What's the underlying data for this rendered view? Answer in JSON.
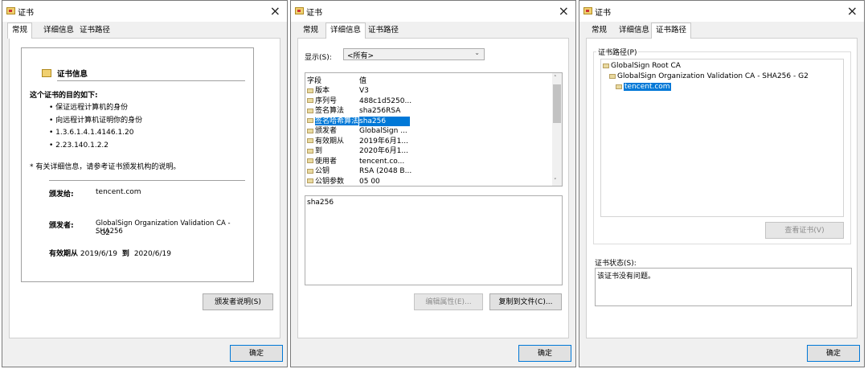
{
  "window_title": "证书",
  "close_glyph": "×",
  "tabs": [
    "常规",
    "详细信息",
    "证书路径"
  ],
  "ok_label": "确定",
  "general": {
    "info_header": "证书信息",
    "purpose_heading": "这个证书的目的如下:",
    "purposes": [
      "保证远程计算机的身份",
      "向远程计算机证明你的身份",
      "1.3.6.1.4.1.4146.1.20",
      "2.23.140.1.2.2"
    ],
    "note": "* 有关详细信息，请参考证书颁发机构的说明。",
    "issued_to_label": "颁发给:",
    "issued_to_value": "tencent.com",
    "issued_by_label": "颁发者:",
    "issued_by_line1": "GlobalSign Organization Validation CA - SHA256",
    "issued_by_line2": "- G2",
    "valid_label": "有效期从",
    "valid_from": "2019/6/19",
    "valid_to_label": "到",
    "valid_to": "2020/6/19",
    "issuer_statement_button": "颁发者说明(S)"
  },
  "details": {
    "show_label": "显示(S):",
    "show_value": "<所有>",
    "col_field": "字段",
    "col_value": "值",
    "rows": [
      {
        "field": "版本",
        "value": "V3"
      },
      {
        "field": "序列号",
        "value": "488c1d5250..."
      },
      {
        "field": "签名算法",
        "value": "sha256RSA"
      },
      {
        "field": "签名哈希算法",
        "value": "sha256"
      },
      {
        "field": "颁发者",
        "value": "GlobalSign ..."
      },
      {
        "field": "有效期从",
        "value": "2019年6月1..."
      },
      {
        "field": "到",
        "value": "2020年6月1..."
      },
      {
        "field": "使用者",
        "value": "tencent.co..."
      },
      {
        "field": "公钥",
        "value": "RSA (2048 B..."
      },
      {
        "field": "公钥参数",
        "value": "05 00"
      }
    ],
    "selected_index": 3,
    "detail_text": "sha256",
    "edit_button": "编辑属性(E)...",
    "copy_button": "复制到文件(C)..."
  },
  "path": {
    "group_label": "证书路径(P)",
    "nodes": [
      "GlobalSign Root CA",
      "GlobalSign Organization Validation CA - SHA256 - G2",
      "tencent.com"
    ],
    "view_button": "查看证书(V)",
    "status_label": "证书状态(S):",
    "status_text": "该证书没有问题。"
  }
}
